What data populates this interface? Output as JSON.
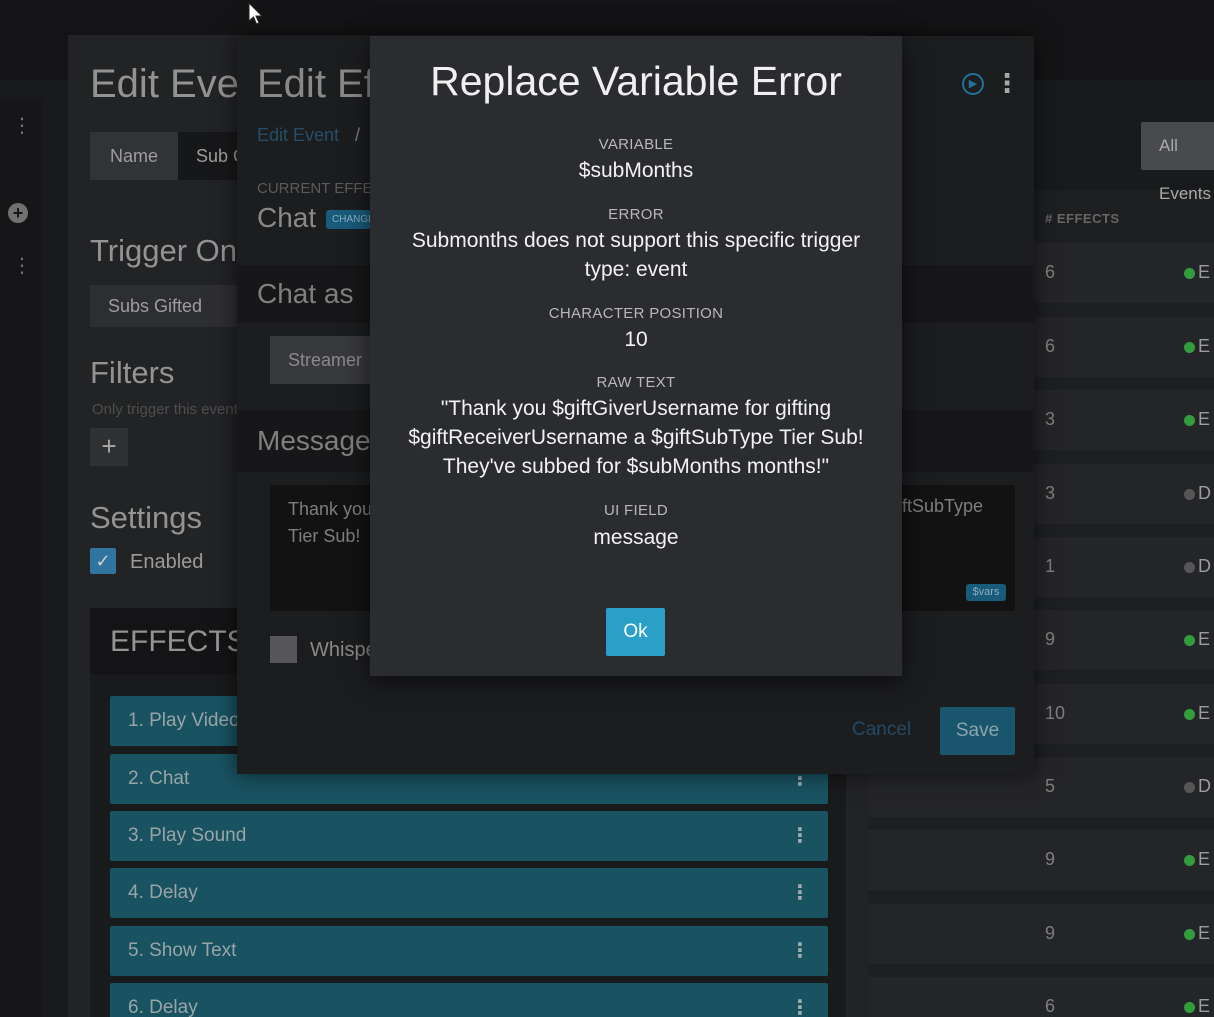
{
  "background": {
    "edit_event": {
      "title": "Edit Event",
      "name_label": "Name",
      "name_value": "Sub Gifted",
      "trigger_heading": "Trigger On",
      "trigger_value": "Subs Gifted",
      "filters_heading": "Filters",
      "filters_description": "Only trigger this event",
      "filters_add": "+",
      "settings_heading": "Settings",
      "enabled_label": "Enabled",
      "effects_heading": "EFFECTS",
      "effects": [
        {
          "label": "1. Play Video"
        },
        {
          "label": "2. Chat"
        },
        {
          "label": "3. Play Sound"
        },
        {
          "label": "4. Delay"
        },
        {
          "label": "5. Show Text"
        },
        {
          "label": "6. Delay"
        }
      ]
    },
    "edit_effect": {
      "title": "Edit Effect",
      "breadcrumb_link": "Edit Event",
      "breadcrumb_sep": "/",
      "current_effect_label": "CURRENT EFFECT",
      "current_effect_name": "Chat",
      "change_badge": "CHANGE",
      "chat_as_heading": "Chat as",
      "streamer_button": "Streamer",
      "message_heading": "Message To Send",
      "message_left": "Thank you\nTier Sub!",
      "message_right": "ftSubType",
      "vars_badge": "$vars",
      "whisper_label": "Whisper",
      "cancel_label": "Cancel",
      "save_label": "Save"
    },
    "event_list": {
      "all_events_label": "All Events",
      "effects_column_header": "# EFFECTS",
      "rows": [
        {
          "effects": "6",
          "status": "E",
          "status_color": "#3fbf4a"
        },
        {
          "effects": "6",
          "status": "E",
          "status_color": "#3fbf4a"
        },
        {
          "effects": "3",
          "status": "E",
          "status_color": "#3fbf4a"
        },
        {
          "effects": "3",
          "status": "D",
          "status_color": "#6a6a6a"
        },
        {
          "effects": "1",
          "status": "D",
          "status_color": "#6a6a6a"
        },
        {
          "effects": "9",
          "status": "E",
          "status_color": "#3fbf4a"
        },
        {
          "effects": "10",
          "status": "E",
          "status_color": "#3fbf4a"
        },
        {
          "effects": "5",
          "status": "D",
          "status_color": "#6a6a6a"
        },
        {
          "effects": "9",
          "status": "E",
          "status_color": "#3fbf4a"
        },
        {
          "effects": "9",
          "status": "E",
          "status_color": "#3fbf4a"
        },
        {
          "effects": "6",
          "status": "E",
          "status_color": "#3fbf4a"
        }
      ]
    }
  },
  "modal": {
    "title": "Replace Variable Error",
    "variable_label": "VARIABLE",
    "variable_value": "$subMonths",
    "error_label": "ERROR",
    "error_value": "Submonths does not support this specific trigger type: event",
    "position_label": "CHARACTER POSITION",
    "position_value": "10",
    "raw_text_label": "RAW TEXT",
    "raw_text_value": "\"Thank you $giftGiverUsername for gifting $giftReceiverUsername a $giftSubType Tier Sub! They've subbed for $subMonths months!\"",
    "ui_field_label": "UI FIELD",
    "ui_field_value": "message",
    "ok_label": "Ok"
  },
  "icons": {
    "kebab": "⋮",
    "check": "✓",
    "play": "▶",
    "add": "+"
  },
  "colors": {
    "accent": "#2a9fc7",
    "effect_item": "#1f6577",
    "enabled_dot": "#3fbf4a",
    "disabled_dot": "#6a6a6a"
  }
}
